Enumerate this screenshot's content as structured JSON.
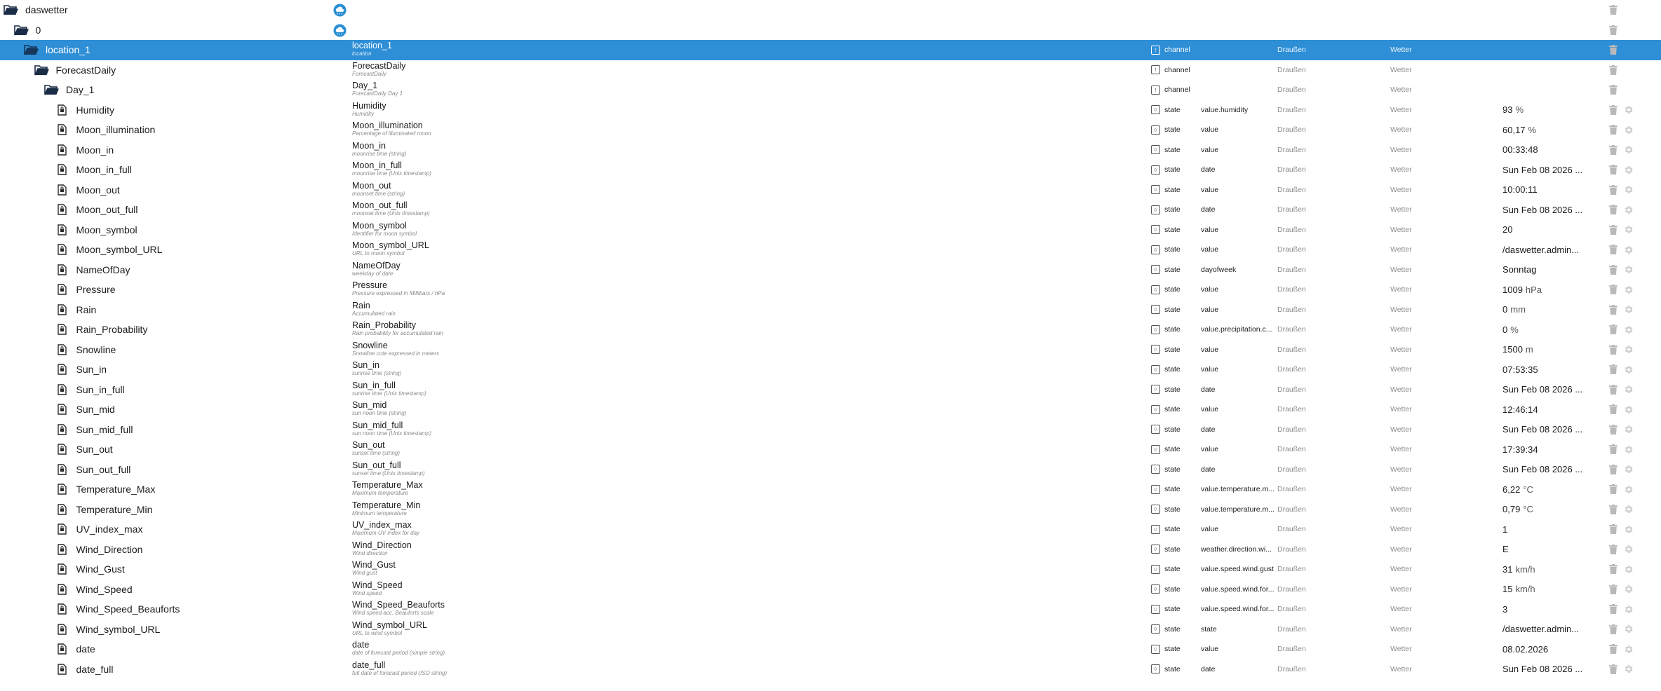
{
  "colors": {
    "folder": "#1a2c46",
    "selected_bg": "#2f8fd6",
    "icon_muted": "#b9b9b9"
  },
  "rows": [
    {
      "name": "daswetter",
      "level": 0,
      "icon": "folder-open-icon",
      "logo": true,
      "title": "",
      "desc": "",
      "type": "",
      "role": "",
      "room": "",
      "func": "",
      "value": "",
      "unit": "",
      "gear": false,
      "selected": false
    },
    {
      "name": "0",
      "level": 1,
      "icon": "folder-open-icon",
      "logo": true,
      "title": "",
      "desc": "",
      "type": "",
      "role": "",
      "room": "",
      "func": "",
      "value": "",
      "unit": "",
      "gear": false,
      "selected": false
    },
    {
      "name": "location_1",
      "level": 2,
      "icon": "folder-open-icon",
      "logo": false,
      "title": "location_1",
      "desc": "location",
      "type": "channel",
      "role": "",
      "room": "Draußen",
      "func": "Wetter",
      "value": "",
      "unit": "",
      "gear": false,
      "selected": true
    },
    {
      "name": "ForecastDaily",
      "level": 3,
      "icon": "folder-open-icon",
      "logo": false,
      "title": "ForecastDaily",
      "desc": "ForecastDaily",
      "type": "channel",
      "role": "",
      "room": "Draußen",
      "func": "Wetter",
      "value": "",
      "unit": "",
      "gear": false,
      "selected": false
    },
    {
      "name": "Day_1",
      "level": 4,
      "icon": "folder-open-icon",
      "logo": false,
      "title": "Day_1",
      "desc": "ForecastDaily Day 1",
      "type": "channel",
      "role": "",
      "room": "Draußen",
      "func": "Wetter",
      "value": "",
      "unit": "",
      "gear": false,
      "selected": false
    },
    {
      "name": "Humidity",
      "level": 5,
      "icon": "file-icon",
      "logo": false,
      "title": "Humidity",
      "desc": "Humidity",
      "type": "state",
      "role": "value.humidity",
      "room": "Draußen",
      "func": "Wetter",
      "value": "93",
      "unit": "%",
      "gear": true,
      "selected": false
    },
    {
      "name": "Moon_illumination",
      "level": 5,
      "icon": "file-icon",
      "logo": false,
      "title": "Moon_illumination",
      "desc": "Percentage of illuminated moon",
      "type": "state",
      "role": "value",
      "room": "Draußen",
      "func": "Wetter",
      "value": "60,17",
      "unit": "%",
      "gear": true,
      "selected": false
    },
    {
      "name": "Moon_in",
      "level": 5,
      "icon": "file-icon",
      "logo": false,
      "title": "Moon_in",
      "desc": "moonrise time (string)",
      "type": "state",
      "role": "value",
      "room": "Draußen",
      "func": "Wetter",
      "value": "00:33:48",
      "unit": "",
      "gear": true,
      "selected": false
    },
    {
      "name": "Moon_in_full",
      "level": 5,
      "icon": "file-icon",
      "logo": false,
      "title": "Moon_in_full",
      "desc": "moonrise time (Unix timestamp)",
      "type": "state",
      "role": "date",
      "room": "Draußen",
      "func": "Wetter",
      "value": "Sun Feb 08 2026 ...",
      "unit": "",
      "gear": true,
      "selected": false
    },
    {
      "name": "Moon_out",
      "level": 5,
      "icon": "file-icon",
      "logo": false,
      "title": "Moon_out",
      "desc": "moonset time (string)",
      "type": "state",
      "role": "value",
      "room": "Draußen",
      "func": "Wetter",
      "value": "10:00:11",
      "unit": "",
      "gear": true,
      "selected": false
    },
    {
      "name": "Moon_out_full",
      "level": 5,
      "icon": "file-icon",
      "logo": false,
      "title": "Moon_out_full",
      "desc": "moonset time (Unix timestamp)",
      "type": "state",
      "role": "date",
      "room": "Draußen",
      "func": "Wetter",
      "value": "Sun Feb 08 2026 ...",
      "unit": "",
      "gear": true,
      "selected": false
    },
    {
      "name": "Moon_symbol",
      "level": 5,
      "icon": "file-icon",
      "logo": false,
      "title": "Moon_symbol",
      "desc": "Identifier for moon symbol",
      "type": "state",
      "role": "value",
      "room": "Draußen",
      "func": "Wetter",
      "value": "20",
      "unit": "",
      "gear": true,
      "selected": false
    },
    {
      "name": "Moon_symbol_URL",
      "level": 5,
      "icon": "file-icon",
      "logo": false,
      "title": "Moon_symbol_URL",
      "desc": "URL to moon symbol",
      "type": "state",
      "role": "value",
      "room": "Draußen",
      "func": "Wetter",
      "value": "/daswetter.admin...",
      "unit": "",
      "gear": true,
      "selected": false
    },
    {
      "name": "NameOfDay",
      "level": 5,
      "icon": "file-icon",
      "logo": false,
      "title": "NameOfDay",
      "desc": "weekday of date",
      "type": "state",
      "role": "dayofweek",
      "room": "Draußen",
      "func": "Wetter",
      "value": "Sonntag",
      "unit": "",
      "gear": true,
      "selected": false
    },
    {
      "name": "Pressure",
      "level": 5,
      "icon": "file-icon",
      "logo": false,
      "title": "Pressure",
      "desc": "Pressure expressed in Millibars / hPa",
      "type": "state",
      "role": "value",
      "room": "Draußen",
      "func": "Wetter",
      "value": "1009",
      "unit": "hPa",
      "gear": true,
      "selected": false
    },
    {
      "name": "Rain",
      "level": 5,
      "icon": "file-icon",
      "logo": false,
      "title": "Rain",
      "desc": "Accumulated rain",
      "type": "state",
      "role": "value",
      "room": "Draußen",
      "func": "Wetter",
      "value": "0",
      "unit": "mm",
      "gear": true,
      "selected": false
    },
    {
      "name": "Rain_Probability",
      "level": 5,
      "icon": "file-icon",
      "logo": false,
      "title": "Rain_Probability",
      "desc": "Rain probability for accumulated rain",
      "type": "state",
      "role": "value.precipitation.c...",
      "room": "Draußen",
      "func": "Wetter",
      "value": "0",
      "unit": "%",
      "gear": true,
      "selected": false
    },
    {
      "name": "Snowline",
      "level": 5,
      "icon": "file-icon",
      "logo": false,
      "title": "Snowline",
      "desc": "Snowline cote expressed in meters",
      "type": "state",
      "role": "value",
      "room": "Draußen",
      "func": "Wetter",
      "value": "1500",
      "unit": "m",
      "gear": true,
      "selected": false
    },
    {
      "name": "Sun_in",
      "level": 5,
      "icon": "file-icon",
      "logo": false,
      "title": "Sun_in",
      "desc": "sunrise time (string)",
      "type": "state",
      "role": "value",
      "room": "Draußen",
      "func": "Wetter",
      "value": "07:53:35",
      "unit": "",
      "gear": true,
      "selected": false
    },
    {
      "name": "Sun_in_full",
      "level": 5,
      "icon": "file-icon",
      "logo": false,
      "title": "Sun_in_full",
      "desc": "sunrise time (Unix timestamp)",
      "type": "state",
      "role": "date",
      "room": "Draußen",
      "func": "Wetter",
      "value": "Sun Feb 08 2026 ...",
      "unit": "",
      "gear": true,
      "selected": false
    },
    {
      "name": "Sun_mid",
      "level": 5,
      "icon": "file-icon",
      "logo": false,
      "title": "Sun_mid",
      "desc": "sun noon time (string)",
      "type": "state",
      "role": "value",
      "room": "Draußen",
      "func": "Wetter",
      "value": "12:46:14",
      "unit": "",
      "gear": true,
      "selected": false
    },
    {
      "name": "Sun_mid_full",
      "level": 5,
      "icon": "file-icon",
      "logo": false,
      "title": "Sun_mid_full",
      "desc": "sun noon time (Unix timestamp)",
      "type": "state",
      "role": "date",
      "room": "Draußen",
      "func": "Wetter",
      "value": "Sun Feb 08 2026 ...",
      "unit": "",
      "gear": true,
      "selected": false
    },
    {
      "name": "Sun_out",
      "level": 5,
      "icon": "file-icon",
      "logo": false,
      "title": "Sun_out",
      "desc": "sunset time (string)",
      "type": "state",
      "role": "value",
      "room": "Draußen",
      "func": "Wetter",
      "value": "17:39:34",
      "unit": "",
      "gear": true,
      "selected": false
    },
    {
      "name": "Sun_out_full",
      "level": 5,
      "icon": "file-icon",
      "logo": false,
      "title": "Sun_out_full",
      "desc": "sunset time (Unix timestamp)",
      "type": "state",
      "role": "date",
      "room": "Draußen",
      "func": "Wetter",
      "value": "Sun Feb 08 2026 ...",
      "unit": "",
      "gear": true,
      "selected": false
    },
    {
      "name": "Temperature_Max",
      "level": 5,
      "icon": "file-icon",
      "logo": false,
      "title": "Temperature_Max",
      "desc": "Maximum temperature",
      "type": "state",
      "role": "value.temperature.m...",
      "room": "Draußen",
      "func": "Wetter",
      "value": "6,22",
      "unit": "°C",
      "gear": true,
      "selected": false
    },
    {
      "name": "Temperature_Min",
      "level": 5,
      "icon": "file-icon",
      "logo": false,
      "title": "Temperature_Min",
      "desc": "Minimum temperature",
      "type": "state",
      "role": "value.temperature.m...",
      "room": "Draußen",
      "func": "Wetter",
      "value": "0,79",
      "unit": "°C",
      "gear": true,
      "selected": false
    },
    {
      "name": "UV_index_max",
      "level": 5,
      "icon": "file-icon",
      "logo": false,
      "title": "UV_index_max",
      "desc": "Maximum UV index for day",
      "type": "state",
      "role": "value",
      "room": "Draußen",
      "func": "Wetter",
      "value": "1",
      "unit": "",
      "gear": true,
      "selected": false
    },
    {
      "name": "Wind_Direction",
      "level": 5,
      "icon": "file-icon",
      "logo": false,
      "title": "Wind_Direction",
      "desc": "Wind direction",
      "type": "state",
      "role": "weather.direction.wi...",
      "room": "Draußen",
      "func": "Wetter",
      "value": "E",
      "unit": "",
      "gear": true,
      "selected": false
    },
    {
      "name": "Wind_Gust",
      "level": 5,
      "icon": "file-icon",
      "logo": false,
      "title": "Wind_Gust",
      "desc": "Wind gust",
      "type": "state",
      "role": "value.speed.wind.gust",
      "room": "Draußen",
      "func": "Wetter",
      "value": "31",
      "unit": "km/h",
      "gear": true,
      "selected": false
    },
    {
      "name": "Wind_Speed",
      "level": 5,
      "icon": "file-icon",
      "logo": false,
      "title": "Wind_Speed",
      "desc": "Wind speed",
      "type": "state",
      "role": "value.speed.wind.for...",
      "room": "Draußen",
      "func": "Wetter",
      "value": "15",
      "unit": "km/h",
      "gear": true,
      "selected": false
    },
    {
      "name": "Wind_Speed_Beauforts",
      "level": 5,
      "icon": "file-icon",
      "logo": false,
      "title": "Wind_Speed_Beauforts",
      "desc": "Wind speed acc. Beauforts scale",
      "type": "state",
      "role": "value.speed.wind.for...",
      "room": "Draußen",
      "func": "Wetter",
      "value": "3",
      "unit": "",
      "gear": true,
      "selected": false
    },
    {
      "name": "Wind_symbol_URL",
      "level": 5,
      "icon": "file-icon",
      "logo": false,
      "title": "Wind_symbol_URL",
      "desc": "URL to wind symbol",
      "type": "state",
      "role": "state",
      "room": "Draußen",
      "func": "Wetter",
      "value": "/daswetter.admin...",
      "unit": "",
      "gear": true,
      "selected": false
    },
    {
      "name": "date",
      "level": 5,
      "icon": "file-icon",
      "logo": false,
      "title": "date",
      "desc": "date of forecast period (simple string)",
      "type": "state",
      "role": "value",
      "room": "Draußen",
      "func": "Wetter",
      "value": "08.02.2026",
      "unit": "",
      "gear": true,
      "selected": false
    },
    {
      "name": "date_full",
      "level": 5,
      "icon": "file-icon",
      "logo": false,
      "title": "date_full",
      "desc": "full date of forecast period (ISO string)",
      "type": "state",
      "role": "date",
      "room": "Draußen",
      "func": "Wetter",
      "value": "Sun Feb 08 2026 ...",
      "unit": "",
      "gear": true,
      "selected": false
    }
  ]
}
